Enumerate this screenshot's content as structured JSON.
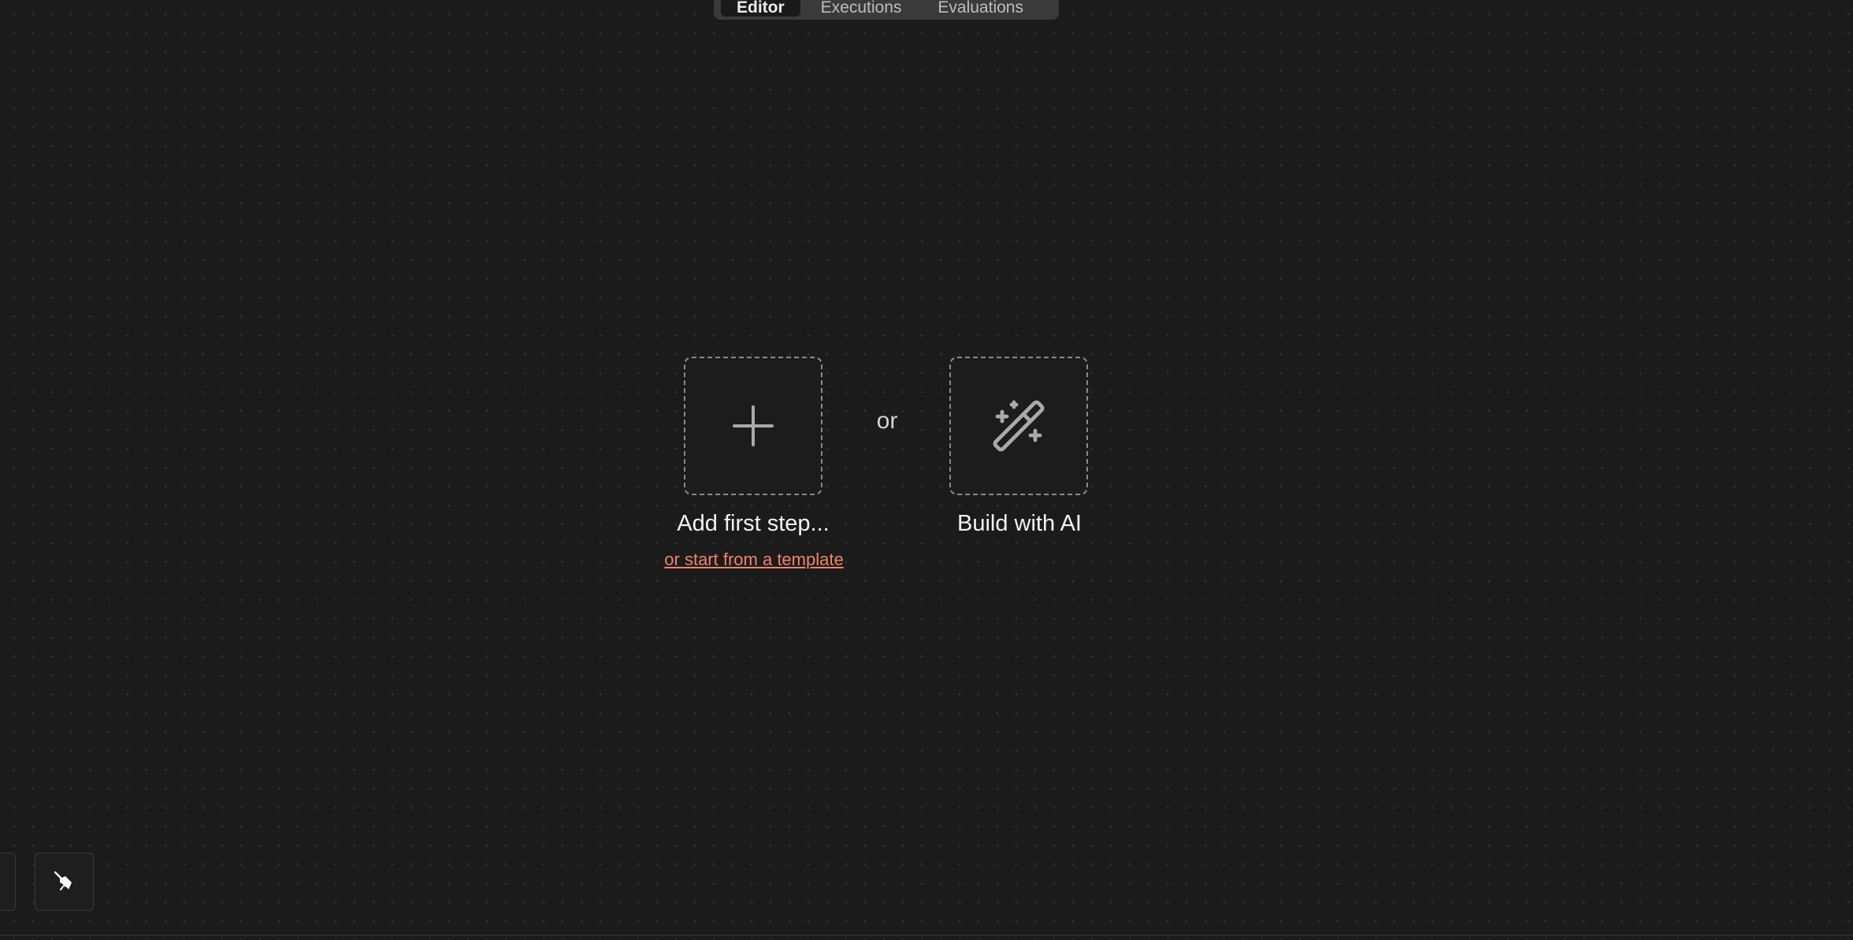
{
  "tabs": [
    {
      "label": "Editor",
      "active": true
    },
    {
      "label": "Executions",
      "active": false
    },
    {
      "label": "Evaluations",
      "active": false
    }
  ],
  "canvas": {
    "add_step": {
      "icon": "plus-icon",
      "label": "Add first step..."
    },
    "separator": "or",
    "build_ai": {
      "icon": "magic-wand-icon",
      "label": "Build with AI"
    },
    "template_link": "or start from a template"
  },
  "bottom_controls": {
    "tidy_icon": "broom-icon"
  },
  "colors": {
    "background": "#1b1b1b",
    "link": "#f08469",
    "dashed_border": "#8a8a8a"
  }
}
